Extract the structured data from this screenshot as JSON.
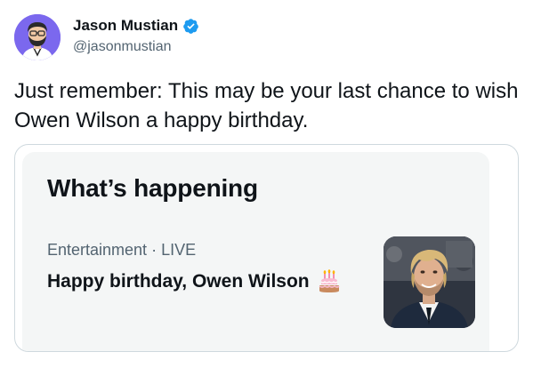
{
  "tweet": {
    "author": {
      "display_name": "Jason Mustian",
      "handle": "@jasonmustian",
      "verified": true
    },
    "text": "Just remember: This may be your last chance to wish Owen Wilson a happy birthday."
  },
  "card": {
    "title": "What’s happening",
    "category": "Entertainment",
    "separator": "·",
    "status": "LIVE",
    "headline": "Happy birthday, Owen Wilson",
    "headline_icon": "birthday-cake-icon",
    "thumbnail_icon": "person-photo"
  },
  "colors": {
    "verified_blue": "#1d9bf0",
    "text_primary": "#0f1419",
    "text_secondary": "#536471",
    "card_border": "#cfd9de",
    "card_bg": "#f4f6f6",
    "avatar_bg": "#7b68ee"
  }
}
